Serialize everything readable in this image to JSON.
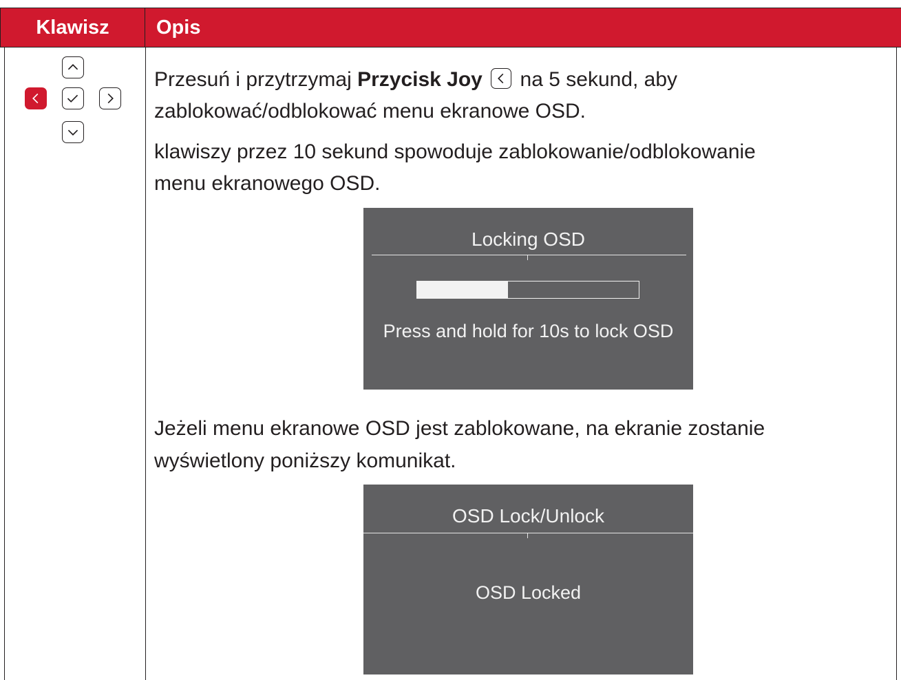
{
  "header": {
    "key_col": "Klawisz",
    "desc_col": "Opis"
  },
  "keys": {
    "up": "up-chevron-icon",
    "left": "left-chevron-icon",
    "ok": "check-icon",
    "right": "right-chevron-icon",
    "down": "down-chevron-icon",
    "highlighted": "left",
    "highlight_color": "#d0192e"
  },
  "desc": {
    "p1_before": "Przesuń i przytrzymaj ",
    "p1_bold": "Przycisk Joy",
    "p1_after": " na 5 sekund, aby",
    "p1_line2": "zablokować/odblokować menu ekranowe OSD.",
    "p2_line1": "klawiszy przez 10 sekund spowoduje zablokowanie/odblokowanie",
    "p2_line2": "menu ekranowego OSD.",
    "p3_line1": "Jeżeli menu ekranowe OSD jest zablokowane, na ekranie zostanie",
    "p3_line2": "wyświetlony poniższy komunikat."
  },
  "osd_locking": {
    "title": "Locking OSD",
    "message": "Press and hold for 10s to lock OSD",
    "progress_fraction": 0.41
  },
  "osd_status": {
    "title": "OSD Lock/Unlock",
    "message": "OSD Locked"
  },
  "colors": {
    "header_bg": "#d0192e",
    "osd_bg": "#606062"
  }
}
